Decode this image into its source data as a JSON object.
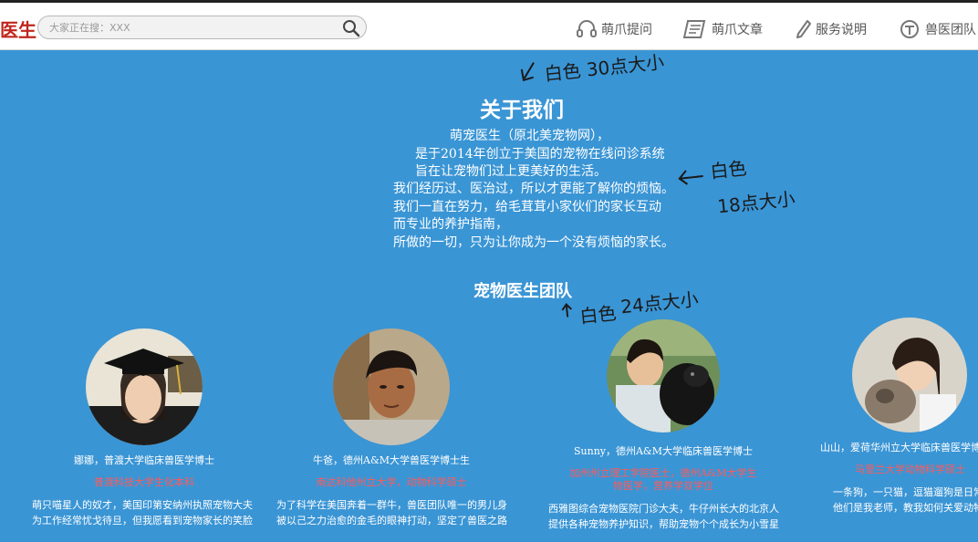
{
  "header": {
    "logo_text": "医生",
    "search_placeholder": "大家正在搜：XXX",
    "nav": [
      {
        "label": "萌爪提问",
        "icon": "headset-icon"
      },
      {
        "label": "萌爪文章",
        "icon": "article-icon"
      },
      {
        "label": "服务说明",
        "icon": "pen-icon"
      },
      {
        "label": "兽医团队",
        "icon": "team-icon"
      }
    ]
  },
  "about": {
    "title": "关于我们",
    "lines": [
      "萌宠医生（原北美宠物网），",
      "是于2014年创立于美国的宠物在线问诊系统",
      "旨在让宠物们过上更美好的生活。",
      "我们经历过、医治过，所以才更能了解你的烦恼。",
      "我们一直在努力，给毛茸茸小家伙们的家长互动",
      "而专业的养护指南，",
      "所做的一切，只为让你成为一个没有烦恼的家长。"
    ]
  },
  "team": {
    "title": "宠物医生团队",
    "doctors": [
      {
        "name": "娜娜，普渡大学临床兽医学博士",
        "school": "普渡科技大学生化本科",
        "desc": [
          "萌只喵星人的奴才，美国印第安纳州执照宠物大夫",
          "为工作经常忧戈待旦，但我愿看到宠物家长的笑脸"
        ]
      },
      {
        "name": "牛爸，德州A&M大学兽医学博士生",
        "school": "南达科他州立大学，动物科学硕士",
        "desc": [
          "为了科学在美国奔着一群牛，兽医团队唯一的男儿身",
          "被以己之力治愈的金毛的眼神打动，坚定了兽医之路"
        ]
      },
      {
        "name": "Sunny，德州A&M大学临床兽医学博士",
        "school": "加州州立理工学院医士，德州A&M大学生物医学，营养学双学位",
        "desc": [
          "西雅图综合宠物医院门诊大夫，牛仔州长大的北京人",
          "提供各种宠物养护知识，帮助宠物个个成长为小雪星"
        ]
      },
      {
        "name": "山山，爱荷华州立大学临床兽医学博",
        "school": "马里兰大学动物科学硕士",
        "desc": [
          "一条狗，一只猫，逗猫遛狗是日常",
          "他们是我老师，教我如何关爱动物"
        ]
      }
    ]
  },
  "annotations": {
    "title_note": "白色 30点大小",
    "body_note_1": "白色",
    "body_note_2": "18点大小",
    "team_note_1": "白色",
    "team_note_2": "24点大小"
  },
  "colors": {
    "background": "#3a95d5",
    "logo": "#c0261c",
    "school_text": "#ff5a5a"
  }
}
